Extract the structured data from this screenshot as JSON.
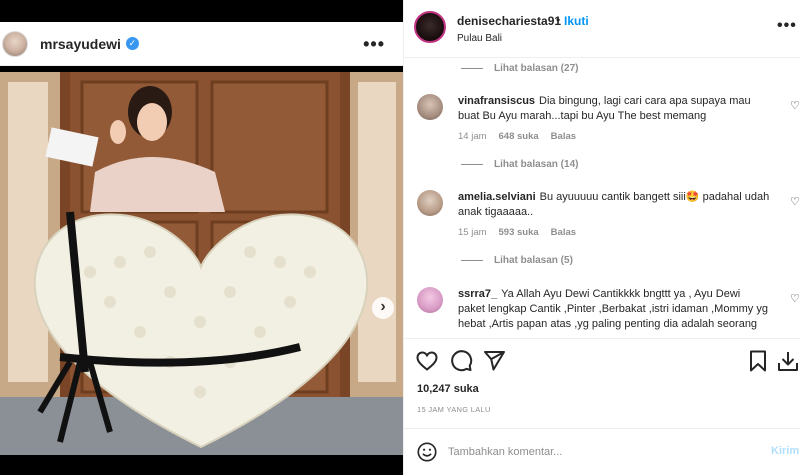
{
  "left": {
    "username": "mrsayudewi",
    "verified_mark": "✓",
    "more": "•••",
    "next_arrow": "›"
  },
  "right": {
    "username": "denisechariesta91",
    "dot": "•",
    "follow": "Ikuti",
    "location": "Pulau Bali",
    "more": "•••"
  },
  "comments": [
    {
      "replies": "Lihat balasan (27)"
    },
    {
      "user": "vinafransiscus",
      "text": "Dia bingung, lagi cari cara apa supaya mau buat Bu Ayu marah...tapi bu Ayu The best memang",
      "time": "14 jam",
      "likes": "648 suka",
      "reply": "Balas",
      "replies": "Lihat balasan (14)"
    },
    {
      "user": "amelia.selviani",
      "text": "Bu ayuuuuu cantik bangett siii🤩 padahal udah anak tigaaaaa..",
      "time": "15 jam",
      "likes": "593 suka",
      "reply": "Balas",
      "replies": "Lihat balasan (5)"
    },
    {
      "user": "ssrra7_",
      "text": "Ya Allah Ayu Dewi Cantikkkk bngttt ya , Ayu Dewi paket lengkap Cantik ,Pinter ,Berbakat ,istri idaman ,Mommy yg hebat ,Artis papan atas ,yg paling penting dia adalah seorang"
    }
  ],
  "footer": {
    "likes": "10,247 suka",
    "time_ago": "15 JAM YANG LALU",
    "comment_placeholder": "Tambahkan komentar...",
    "post_label": "Kirim"
  },
  "icons": {
    "like": "heart-icon",
    "comment": "comment-icon",
    "share": "send-icon",
    "save": "bookmark-icon",
    "download": "download-icon",
    "emoji": "emoji-icon"
  },
  "colors": {
    "link": "#0095f6",
    "story_ring": "#c13584",
    "verified": "#3897f0"
  }
}
